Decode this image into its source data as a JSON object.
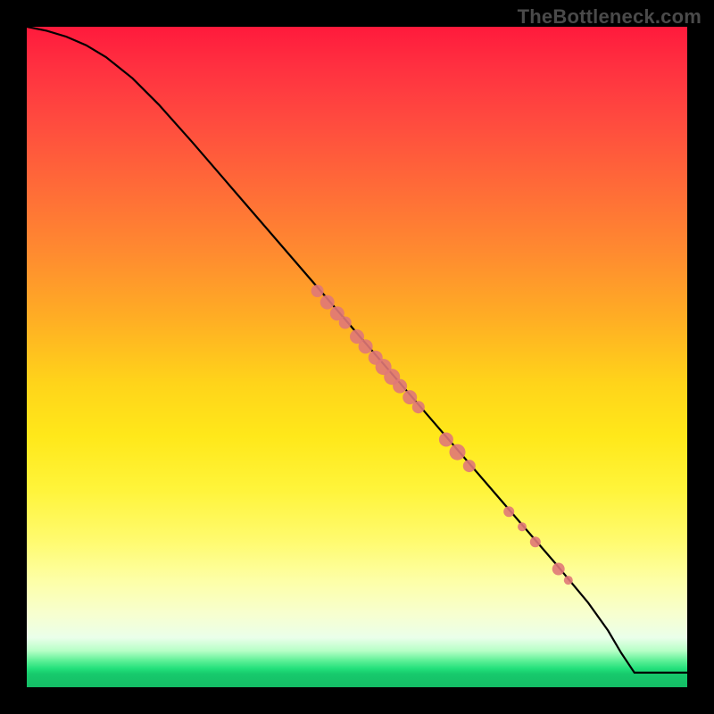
{
  "watermark": "TheBottleneck.com",
  "colors": {
    "curve": "#000000",
    "marker_fill": "#e07878",
    "marker_stroke": "#c85c5c"
  },
  "chart_data": {
    "type": "line",
    "title": "",
    "xlabel": "",
    "ylabel": "",
    "xlim": [
      0,
      100
    ],
    "ylim": [
      0,
      100
    ],
    "grid": false,
    "series": [
      {
        "name": "curve",
        "x": [
          0,
          3,
          6,
          9,
          12,
          16,
          20,
          25,
          30,
          35,
          40,
          45,
          50,
          55,
          60,
          65,
          70,
          75,
          80,
          85,
          88,
          90,
          92,
          100
        ],
        "y": [
          100,
          99.4,
          98.5,
          97.2,
          95.4,
          92.2,
          88.2,
          82.6,
          76.8,
          71.0,
          65.2,
          59.4,
          53.6,
          47.8,
          42.0,
          36.2,
          30.4,
          24.6,
          18.8,
          12.8,
          8.6,
          5.2,
          2.2,
          2.2
        ]
      }
    ],
    "markers": [
      {
        "x": 44.0,
        "y": 60.0,
        "r": 7
      },
      {
        "x": 45.5,
        "y": 58.3,
        "r": 8
      },
      {
        "x": 47.0,
        "y": 56.6,
        "r": 8
      },
      {
        "x": 48.2,
        "y": 55.2,
        "r": 7
      },
      {
        "x": 50.0,
        "y": 53.1,
        "r": 8
      },
      {
        "x": 51.3,
        "y": 51.6,
        "r": 8
      },
      {
        "x": 52.8,
        "y": 49.9,
        "r": 8
      },
      {
        "x": 54.0,
        "y": 48.5,
        "r": 9
      },
      {
        "x": 55.3,
        "y": 47.0,
        "r": 9
      },
      {
        "x": 56.5,
        "y": 45.6,
        "r": 8
      },
      {
        "x": 58.0,
        "y": 43.9,
        "r": 8
      },
      {
        "x": 59.3,
        "y": 42.4,
        "r": 7
      },
      {
        "x": 63.5,
        "y": 37.5,
        "r": 8
      },
      {
        "x": 65.2,
        "y": 35.6,
        "r": 9
      },
      {
        "x": 67.0,
        "y": 33.5,
        "r": 7
      },
      {
        "x": 73.0,
        "y": 26.6,
        "r": 6
      },
      {
        "x": 75.0,
        "y": 24.3,
        "r": 5
      },
      {
        "x": 77.0,
        "y": 22.0,
        "r": 6
      },
      {
        "x": 80.5,
        "y": 17.9,
        "r": 7
      },
      {
        "x": 82.0,
        "y": 16.2,
        "r": 5
      }
    ]
  }
}
